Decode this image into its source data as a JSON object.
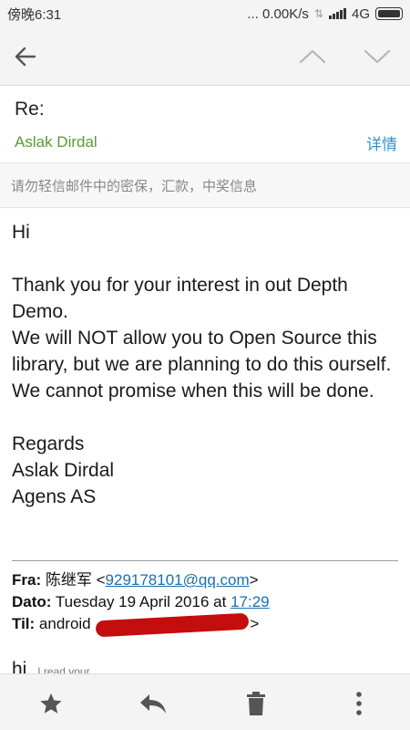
{
  "status_bar": {
    "time": "傍晚6:31",
    "network_speed": "... 0.00K/s",
    "network_type": "4G",
    "icons": [
      "data-arrows-icon",
      "signal-icon",
      "battery-icon"
    ]
  },
  "nav": {
    "icons": [
      "back-arrow-icon",
      "previous-chevron-icon",
      "next-chevron-icon"
    ]
  },
  "email": {
    "subject": "Re:",
    "sender": "Aslak Dirdal",
    "details_link": "详情",
    "warning": "请勿轻信邮件中的密保，汇款，中奖信息",
    "body": {
      "greeting": "Hi",
      "paragraph": [
        "Thank you for your interest in out Depth Demo.",
        "We will NOT allow you to Open Source this library, but we are planning to do this ourself. We cannot promise when this will be done."
      ],
      "closing": "Regards",
      "signature_name": "Aslak Dirdal",
      "signature_company": "Agens AS"
    },
    "quoted_header": {
      "from_label": "Fra:",
      "from_name": "陈继军",
      "from_open": "<",
      "from_email": "929178101@qq.com",
      "from_close": ">",
      "date_label": "Dato:",
      "date_text": "Tuesday 19 April 2016 at",
      "date_time": "17:29",
      "to_label": "Til:",
      "to_name": "android",
      "to_close": ">"
    },
    "quoted_preview": "hi",
    "quoted_preview_small": "I read your"
  },
  "bottom_bar": {
    "icons": [
      "star-icon",
      "reply-icon",
      "delete-icon",
      "more-options-icon"
    ]
  },
  "colors": {
    "sender": "#5c9a2e",
    "link": "#3a8fc8",
    "redaction": "#c40d0d",
    "bar_background": "#f4f4f4"
  }
}
